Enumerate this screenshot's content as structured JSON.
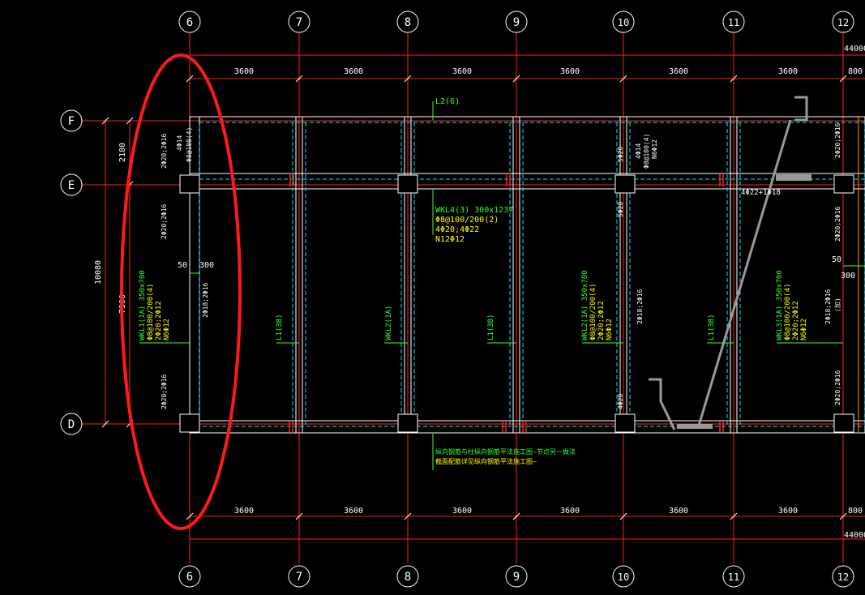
{
  "axes_columns": [
    "6",
    "7",
    "8",
    "9",
    "10",
    "11",
    "12"
  ],
  "axes_rows": [
    "F",
    "E",
    "D"
  ],
  "dims": {
    "spans": [
      "3600",
      "3600",
      "3600",
      "3600",
      "3600",
      "3600",
      "800"
    ],
    "total_top": "44000",
    "total_bottom": "44000",
    "left_outer": "10080",
    "left_inner_top": "2180",
    "left_inner_bottom": "7900",
    "offset_50": "50",
    "offset_300": "300",
    "right_50": "50",
    "right_300": "300"
  },
  "labels": {
    "l2": "L2(6)",
    "wkl4_1": "WKL4(3) 300x1237",
    "wkl4_2": "Φ8@100/200(2)",
    "wkl4_3": "4Φ20;4Φ22",
    "wkl4_4": "N12Φ12",
    "wkl1_left": [
      "WKL1(1A) 350x700",
      "Φ8@100/200(4)",
      "2Φ20;2Φ12",
      "N6Φ12"
    ],
    "wkl2_mid": [
      "WKL2(1A) 350x700",
      "Φ8@100/200(4)",
      "2Φ20;2Φ12",
      "N6Φ12"
    ],
    "wkl3_right": [
      "WKL3(1A) 350x700",
      "Φ8@100/200(4)",
      "2Φ20;2Φ12",
      "N6Φ12"
    ],
    "l1_a": "L1(3B)",
    "wkl2_b": "WKL2(1A)",
    "l1_b": "L1(3B)",
    "l1_c": "L1(3B)",
    "col_top_left_a": "2Φ20;2Φ16",
    "col_top_left_b": "4Φ14",
    "col_top_left_c": "Φ8@100(4)",
    "col_left_mid": "2Φ20;2Φ16",
    "col_left_bot": "2Φ20;2Φ16",
    "col_left_side": "2Φ18;2Φ16",
    "col_10_top_a": "5Φ20",
    "col_10_top_b": "4Φ14",
    "col_10_top_c": "Φ8@100(4)",
    "col_10_top_d": "N6Φ12",
    "col_10_mid": "5Φ20",
    "col_10_bot": "4Φ20",
    "col_10_side": "2Φ18;2Φ16",
    "col_11_note": "4Φ22+1Φ18",
    "col_12_a": "2Φ20;2Φ16",
    "col_12_b": "2Φ20;2Φ16",
    "col_12_c": "2Φ18;2Φ16",
    "col_12_d": "2Φ20;2Φ16",
    "col_12_e": "(加)",
    "note_1": "纵向钢筋与柱纵向钢筋平法施工图—节点另一做法",
    "note_2": "截面配筋详见纵向钢筋平法施工图—"
  },
  "colors": {
    "background": "#000000",
    "axis_line": "#ff2020",
    "white": "#ffffff",
    "cyan": "#00e5ff",
    "yellow": "#ffff00",
    "green": "#33ff33",
    "highlight": "#ff1a1a",
    "gray": "#9a9a9a"
  }
}
